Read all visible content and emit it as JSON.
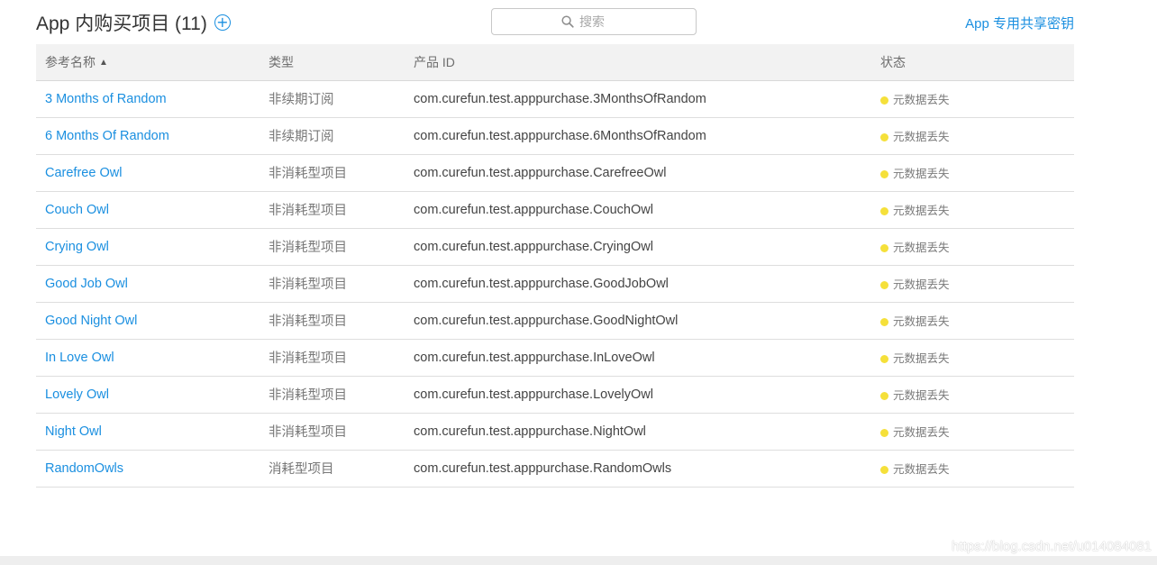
{
  "header": {
    "title": "App 内购买项目 (11)",
    "add_icon": "plus-circle-icon",
    "search_placeholder": "搜索",
    "search_icon": "magnifier-icon",
    "shared_secret_link": "App 专用共享密钥"
  },
  "table": {
    "columns": [
      {
        "label": "参考名称",
        "sort": "ascending"
      },
      {
        "label": "类型"
      },
      {
        "label": "产品 ID"
      },
      {
        "label": "状态"
      }
    ],
    "rows": [
      {
        "name": "3 Months of Random",
        "type": "非续期订阅",
        "product_id": "com.curefun.test.apppurchase.3MonthsOfRandom",
        "status": "元数据丢失"
      },
      {
        "name": "6 Months Of Random",
        "type": "非续期订阅",
        "product_id": "com.curefun.test.apppurchase.6MonthsOfRandom",
        "status": "元数据丢失"
      },
      {
        "name": "Carefree Owl",
        "type": "非消耗型项目",
        "product_id": "com.curefun.test.apppurchase.CarefreeOwl",
        "status": "元数据丢失"
      },
      {
        "name": "Couch Owl",
        "type": "非消耗型项目",
        "product_id": "com.curefun.test.apppurchase.CouchOwl",
        "status": "元数据丢失"
      },
      {
        "name": "Crying Owl",
        "type": "非消耗型项目",
        "product_id": "com.curefun.test.apppurchase.CryingOwl",
        "status": "元数据丢失"
      },
      {
        "name": "Good Job Owl",
        "type": "非消耗型项目",
        "product_id": "com.curefun.test.apppurchase.GoodJobOwl",
        "status": "元数据丢失"
      },
      {
        "name": "Good Night Owl",
        "type": "非消耗型项目",
        "product_id": "com.curefun.test.apppurchase.GoodNightOwl",
        "status": "元数据丢失"
      },
      {
        "name": "In Love Owl",
        "type": "非消耗型项目",
        "product_id": "com.curefun.test.apppurchase.InLoveOwl",
        "status": "元数据丢失"
      },
      {
        "name": "Lovely Owl",
        "type": "非消耗型项目",
        "product_id": "com.curefun.test.apppurchase.LovelyOwl",
        "status": "元数据丢失"
      },
      {
        "name": "Night Owl",
        "type": "非消耗型项目",
        "product_id": "com.curefun.test.apppurchase.NightOwl",
        "status": "元数据丢失"
      },
      {
        "name": "RandomOwls",
        "type": "消耗型项目",
        "product_id": "com.curefun.test.apppurchase.RandomOwls",
        "status": "元数据丢失"
      }
    ]
  },
  "colors": {
    "link": "#1a8fe0",
    "status_dot": "#f5e03a",
    "header_bg": "#f2f2f2"
  },
  "watermark": "https://blog.csdn.net/u014084081"
}
